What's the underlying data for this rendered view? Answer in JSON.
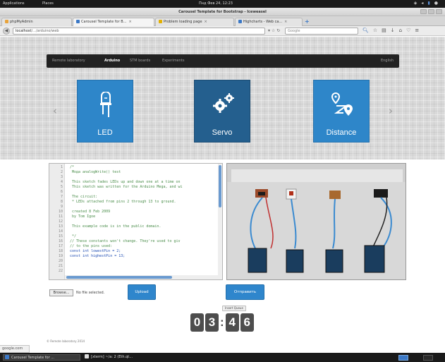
{
  "system_panel": {
    "applications": "Applications",
    "places": "Places",
    "clock": "Пнд Фев 24, 12:23"
  },
  "window": {
    "title": "Carousel Template for Bootstrap - Iceweasel"
  },
  "tabs": [
    {
      "label": "phpMyAdmin",
      "color": "#e8a33b"
    },
    {
      "label": "Carousel Template for B...",
      "color": "#3b78c6"
    },
    {
      "label": "Problem loading page",
      "color": "#e3b000"
    },
    {
      "label": "Highcharts - Web ca...",
      "color": "#3b78c6"
    }
  ],
  "navbar": {
    "url_prefix": "localhost",
    "url_rest": "/.../arduino/web",
    "search_placeholder": "Google"
  },
  "site_nav": {
    "brand": "Remote laboratory",
    "items": [
      "Arduino",
      "STM boards",
      "Experiments"
    ],
    "language": "English"
  },
  "tiles": [
    {
      "label": "LED",
      "icon": "led-icon"
    },
    {
      "label": "Servo",
      "icon": "gears-icon"
    },
    {
      "label": "Distance",
      "icon": "route-icon"
    }
  ],
  "code_lines": [
    {
      "num": "1",
      "text": "/*",
      "kw": false
    },
    {
      "num": "2",
      "text": "  Мода analogWrite() test",
      "kw": false
    },
    {
      "num": "3",
      "text": "",
      "kw": false
    },
    {
      "num": "4",
      "text": "  This sketch fades LEDs up and down one at a time on",
      "kw": false
    },
    {
      "num": "5",
      "text": "  This sketch was written for the Arduino Mega, and wi",
      "kw": false
    },
    {
      "num": "6",
      "text": "",
      "kw": false
    },
    {
      "num": "7",
      "text": "  The circuit:",
      "kw": false
    },
    {
      "num": "8",
      "text": "  * LEDs attached from pins 2 through 13 to ground.",
      "kw": false
    },
    {
      "num": "9",
      "text": "",
      "kw": false
    },
    {
      "num": "10",
      "text": "  created 8 Feb 2009",
      "kw": false
    },
    {
      "num": "11",
      "text": "  by Tom Igoe",
      "kw": false
    },
    {
      "num": "12",
      "text": "",
      "kw": false
    },
    {
      "num": "13",
      "text": "  This example code is in the public domain.",
      "kw": false
    },
    {
      "num": "14",
      "text": "",
      "kw": false
    },
    {
      "num": "15",
      "text": " */",
      "kw": false
    },
    {
      "num": "16",
      "text": "// These constants won't change.  They're used to giv",
      "kw": false
    },
    {
      "num": "17",
      "text": "// to the pins used:",
      "kw": false
    },
    {
      "num": "18",
      "text": "const int lowestPin = 2;",
      "kw": true
    },
    {
      "num": "19",
      "text": "const int highestPin = 13;",
      "kw": true
    },
    {
      "num": "20",
      "text": "",
      "kw": false
    },
    {
      "num": "21",
      "text": "",
      "kw": false
    },
    {
      "num": "22",
      "text": "",
      "kw": false
    }
  ],
  "controls": {
    "browse_label": "Browse...",
    "no_file_label": "No file selected.",
    "upload_label": "Upload",
    "send_label": "Отправить"
  },
  "queue_badge": "Insert Queue",
  "timer": {
    "d1": "0",
    "d2": "3",
    "d3": "4",
    "d4": "6"
  },
  "footnote": "© Remote laboratory 2014",
  "status_text": "google.com",
  "taskbar": {
    "task1": "Carousel Template for ...",
    "task2": "[xterm] ~/a: 2 (Eth.qt..."
  }
}
